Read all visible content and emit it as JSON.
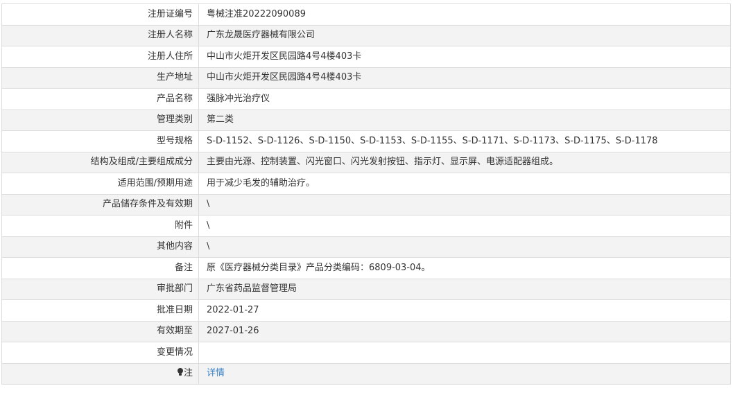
{
  "rows": [
    {
      "label": "注册证编号",
      "value": "粤械注准20222090089"
    },
    {
      "label": "注册人名称",
      "value": "广东龙晟医疗器械有限公司"
    },
    {
      "label": "注册人住所",
      "value": "中山市火炬开发区民园路4号4楼403卡"
    },
    {
      "label": "生产地址",
      "value": "中山市火炬开发区民园路4号4楼403卡"
    },
    {
      "label": "产品名称",
      "value": "强脉冲光治疗仪"
    },
    {
      "label": "管理类别",
      "value": "第二类"
    },
    {
      "label": "型号规格",
      "value": "S-D-1152、S-D-1126、S-D-1150、S-D-1153、S-D-1155、S-D-1171、S-D-1173、S-D-1175、S-D-1178"
    },
    {
      "label": "结构及组成/主要组成成分",
      "value": "主要由光源、控制装置、闪光窗口、闪光发射按钮、指示灯、显示屏、电源适配器组成。"
    },
    {
      "label": "适用范围/预期用途",
      "value": "用于减少毛发的辅助治疗。"
    },
    {
      "label": "产品储存条件及有效期",
      "value": "\\"
    },
    {
      "label": "附件",
      "value": "\\"
    },
    {
      "label": "其他内容",
      "value": "\\"
    },
    {
      "label": "备注",
      "value": "原《医疗器械分类目录》产品分类编码：6809-03-04。"
    },
    {
      "label": "审批部门",
      "value": "广东省药品监督管理局"
    },
    {
      "label": "批准日期",
      "value": "2022-01-27"
    },
    {
      "label": "有效期至",
      "value": "2027-01-26"
    },
    {
      "label": "变更情况",
      "value": ""
    }
  ],
  "note_row": {
    "label": "注",
    "link_text": "详情",
    "icon": "bulb-icon"
  },
  "colors": {
    "border": "#dcdcdc",
    "alt_row": "#f3f3f3",
    "link": "#3a83c7",
    "text": "#333333"
  }
}
